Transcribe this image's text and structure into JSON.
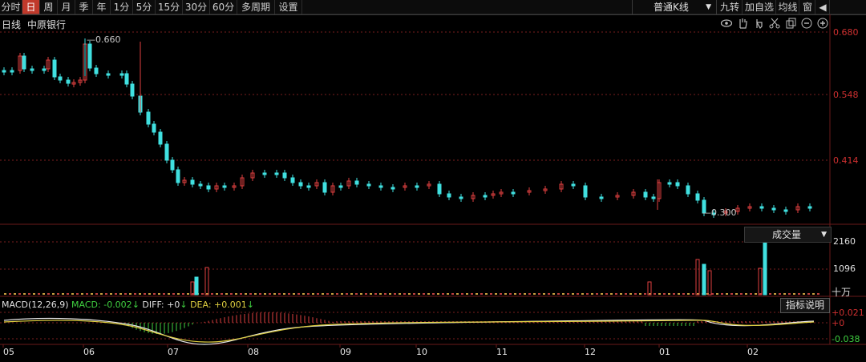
{
  "toolbar": {
    "periods": [
      "分时",
      "日",
      "周",
      "月",
      "季",
      "年",
      "1分",
      "5分",
      "15分",
      "30分",
      "60分",
      "多周期",
      "设置"
    ],
    "active": "日",
    "kline_type": "普通K线",
    "right_buttons": [
      "九转",
      "加自选",
      "均线",
      "窗"
    ]
  },
  "chart": {
    "period_label": "日线",
    "stock_name": "中原银行",
    "price_axis": [
      "0.680",
      "0.548",
      "0.414"
    ],
    "high_marker": "0.660",
    "low_marker": "0.300",
    "volume_selector": "成交量",
    "volume_axis": [
      "2160",
      "1096"
    ],
    "volume_unit": "十万",
    "macd": {
      "name": "MACD(12,26,9)",
      "macd": "MACD: -0.002",
      "diff": "DIFF: +0",
      "dea": "DEA: +0.001",
      "axis": [
        "+0.021",
        "+0",
        "-0.038"
      ],
      "explain_button": "指标说明"
    },
    "months": [
      "05",
      "06",
      "07",
      "08",
      "09",
      "10",
      "11",
      "12",
      "01",
      "02"
    ]
  },
  "colors": {
    "up": "#e04040",
    "down": "#40e0e0",
    "grid": "#7a1e1e",
    "accent": "#c0392b"
  },
  "chart_data": {
    "type": "candlestick",
    "x": [
      "05",
      "06",
      "07",
      "08",
      "09",
      "10",
      "11",
      "12",
      "01",
      "02"
    ],
    "price_ylim": [
      0.3,
      0.68
    ],
    "price_high": 0.66,
    "price_low": 0.3,
    "volume_ticks": [
      2160,
      1096
    ],
    "macd_ticks": [
      0.021,
      0,
      -0.038
    ]
  }
}
